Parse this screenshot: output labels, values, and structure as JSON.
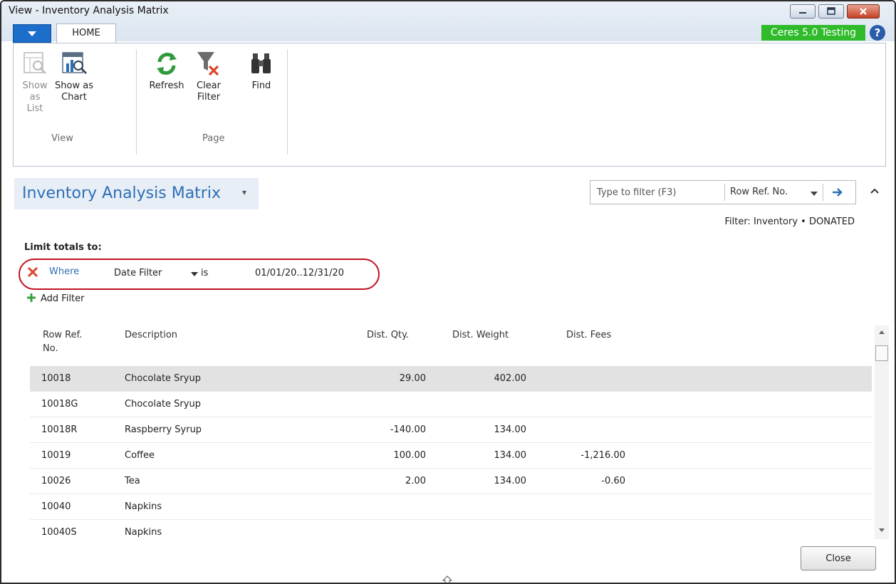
{
  "window": {
    "title": "View - Inventory Analysis Matrix"
  },
  "tabs": {
    "home": "HOME"
  },
  "company_badge": "Ceres 5.0 Testing",
  "ribbon": {
    "view_group": "View",
    "page_group": "Page",
    "show_as_list": [
      "Show",
      "as List"
    ],
    "show_as_chart": [
      "Show as",
      "Chart"
    ],
    "refresh": "Refresh",
    "clear_filter": [
      "Clear",
      "Filter"
    ],
    "find": "Find"
  },
  "page": {
    "title": "Inventory Analysis Matrix"
  },
  "filter": {
    "placeholder": "Type to filter (F3)",
    "field": "Row Ref. No.",
    "summary": "Filter: Inventory • DONATED"
  },
  "limit_totals": {
    "label": "Limit totals to:",
    "where": "Where",
    "field": "Date Filter",
    "operator": "is",
    "value": "01/01/20..12/31/20",
    "add_filter": "Add Filter"
  },
  "grid": {
    "columns": [
      "Row Ref.\nNo.",
      "Description",
      "Dist. Qty.",
      "Dist. Weight",
      "Dist. Fees"
    ],
    "rows": [
      {
        "ref": "10018",
        "desc": "Chocolate Sryup",
        "qty": "29.00",
        "weight": "402.00",
        "fees": ""
      },
      {
        "ref": "10018G",
        "desc": "Chocolate Sryup",
        "qty": "",
        "weight": "",
        "fees": ""
      },
      {
        "ref": "10018R",
        "desc": "Raspberry Syrup",
        "qty": "-140.00",
        "weight": "134.00",
        "fees": ""
      },
      {
        "ref": "10019",
        "desc": "Coffee",
        "qty": "100.00",
        "weight": "134.00",
        "fees": "-1,216.00"
      },
      {
        "ref": "10026",
        "desc": "Tea",
        "qty": "2.00",
        "weight": "134.00",
        "fees": "-0.60"
      },
      {
        "ref": "10040",
        "desc": "Napkins",
        "qty": "",
        "weight": "",
        "fees": ""
      },
      {
        "ref": "10040S",
        "desc": "Napkins",
        "qty": "",
        "weight": "",
        "fees": ""
      }
    ]
  },
  "close_button": "Close",
  "colors": {
    "accent": "#2c6fb7",
    "badge": "#2fbb2a",
    "highlight_oval": "#c0121f",
    "selected_row": "#e2e2e2"
  }
}
